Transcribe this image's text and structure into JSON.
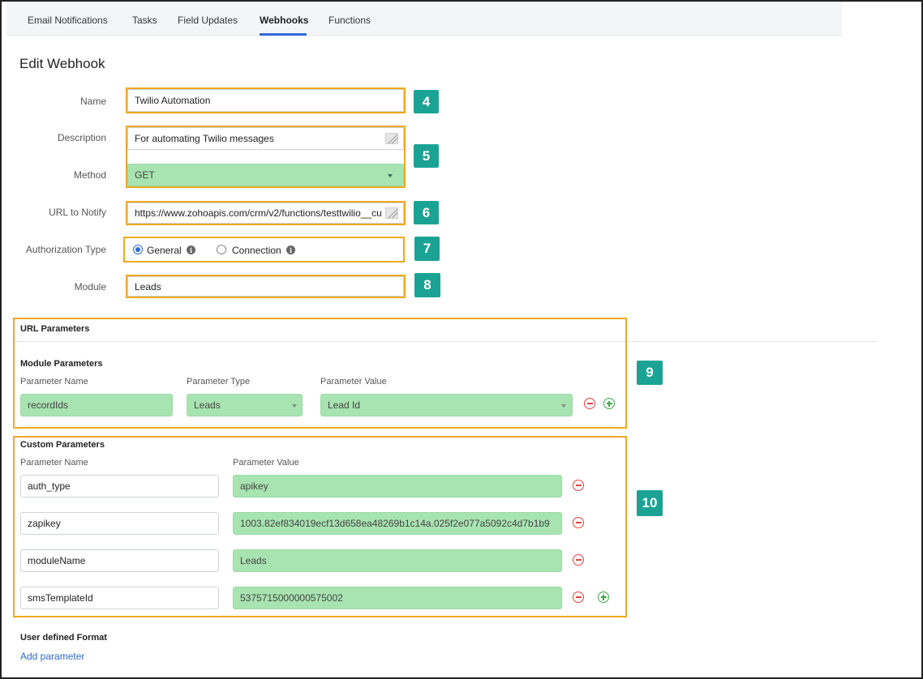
{
  "tabs": [
    {
      "label": "Email Notifications"
    },
    {
      "label": "Tasks"
    },
    {
      "label": "Field Updates"
    },
    {
      "label": "Webhooks"
    },
    {
      "label": "Functions"
    }
  ],
  "page_title": "Edit Webhook",
  "form": {
    "name_label": "Name",
    "name_value": "Twilio Automation",
    "description_label": "Description",
    "description_value": "For automating Twilio messages",
    "method_label": "Method",
    "method_value": "GET",
    "url_label": "URL to Notify",
    "url_value": "https://www.zohoapis.com/crm/v2/functions/testtwilio__cu",
    "auth_label": "Authorization Type",
    "auth_general": "General",
    "auth_connection": "Connection",
    "module_label": "Module",
    "module_value": "Leads"
  },
  "badges": {
    "b4": "4",
    "b5": "5",
    "b6": "6",
    "b7": "7",
    "b8": "8",
    "b9": "9",
    "b10": "10"
  },
  "url_parameters": {
    "title": "URL Parameters",
    "module_params_title": "Module Parameters",
    "col_name": "Parameter Name",
    "col_type": "Parameter Type",
    "col_value": "Parameter Value",
    "row": {
      "name": "recordIds",
      "type": "Leads",
      "value": "Lead Id"
    }
  },
  "custom_parameters": {
    "title": "Custom Parameters",
    "col_name": "Parameter Name",
    "col_value": "Parameter Value",
    "rows": [
      {
        "name": "auth_type",
        "value": "apikey"
      },
      {
        "name": "zapikey",
        "value": "1003.82ef834019ecf13d658ea48269b1c14a.025f2e077a5092c4d7b1b9"
      },
      {
        "name": "moduleName",
        "value": "Leads"
      },
      {
        "name": "smsTemplateId",
        "value": "5375715000000575002"
      }
    ]
  },
  "user_defined": {
    "title": "User defined Format",
    "add_link": "Add parameter"
  },
  "colors": {
    "accent": "#2d6ad6",
    "highlight_box": "#f0a81e",
    "badge": "#1aa394",
    "field_green": "#a8e4b1",
    "remove": "#e0443e",
    "add": "#3aa94a"
  }
}
